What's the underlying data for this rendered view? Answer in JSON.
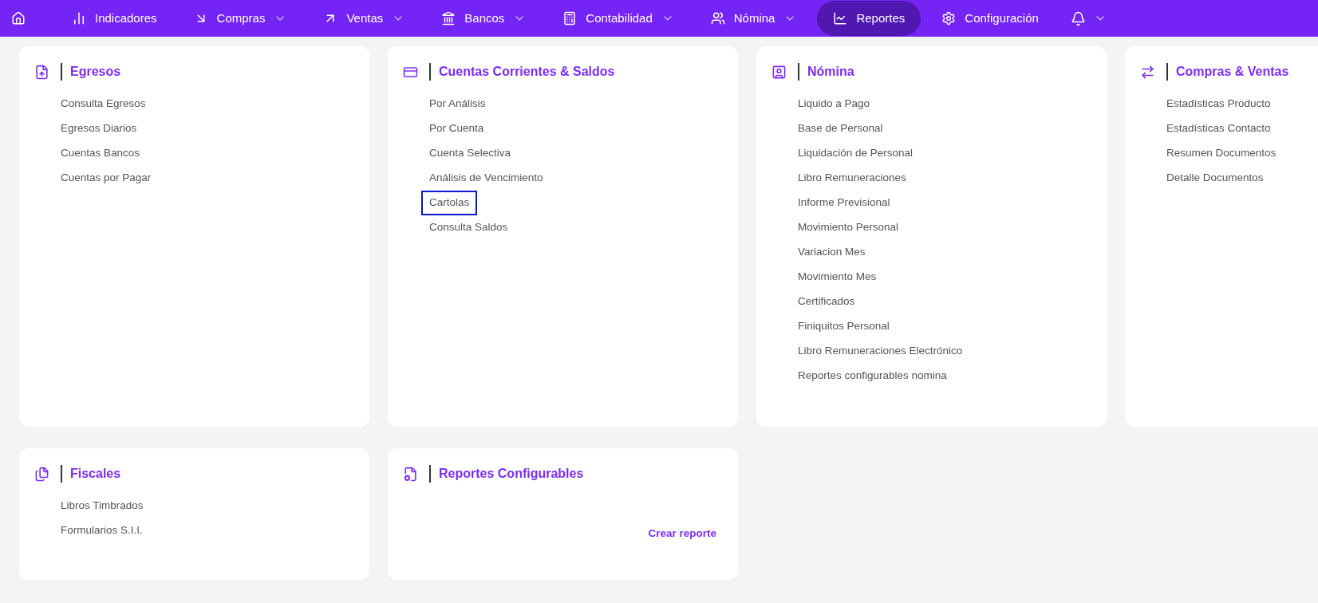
{
  "nav": {
    "items": [
      {
        "label": "Indicadores",
        "dropdown": false,
        "selected": false
      },
      {
        "label": "Compras",
        "dropdown": true,
        "selected": false
      },
      {
        "label": "Ventas",
        "dropdown": true,
        "selected": false
      },
      {
        "label": "Bancos",
        "dropdown": true,
        "selected": false
      },
      {
        "label": "Contabilidad",
        "dropdown": true,
        "selected": false
      },
      {
        "label": "Nómina",
        "dropdown": true,
        "selected": false
      },
      {
        "label": "Reportes",
        "dropdown": false,
        "selected": true
      },
      {
        "label": "Configuración",
        "dropdown": false,
        "selected": false
      }
    ],
    "notifications": {
      "dropdown": true
    }
  },
  "sections": [
    {
      "title": "Egresos",
      "items": [
        {
          "label": "Consulta Egresos",
          "focused": false
        },
        {
          "label": "Egresos Diarios",
          "focused": false
        },
        {
          "label": "Cuentas Bancos",
          "focused": false
        },
        {
          "label": "Cuentas por Pagar",
          "focused": false
        }
      ]
    },
    {
      "title": "Cuentas Corrientes & Saldos",
      "items": [
        {
          "label": "Por Análisis",
          "focused": false
        },
        {
          "label": "Por Cuenta",
          "focused": false
        },
        {
          "label": "Cuenta Selectiva",
          "focused": false
        },
        {
          "label": "Análisis de Vencimiento",
          "focused": false
        },
        {
          "label": "Cartolas",
          "focused": true
        },
        {
          "label": "Consulta Saldos",
          "focused": false
        }
      ]
    },
    {
      "title": "Nómina",
      "items": [
        {
          "label": "Liquido a Pago",
          "focused": false
        },
        {
          "label": "Base de Personal",
          "focused": false
        },
        {
          "label": "Liquidación de Personal",
          "focused": false
        },
        {
          "label": "Libro Remuneraciones",
          "focused": false
        },
        {
          "label": "Informe Previsional",
          "focused": false
        },
        {
          "label": "Movimiento Personal",
          "focused": false
        },
        {
          "label": "Variacion Mes",
          "focused": false
        },
        {
          "label": "Movimiento Mes",
          "focused": false
        },
        {
          "label": "Certificados",
          "focused": false
        },
        {
          "label": "Finiquitos Personal",
          "focused": false
        },
        {
          "label": "Libro Remuneraciones Electrónico",
          "focused": false
        },
        {
          "label": "Reportes configurables nomina",
          "focused": false
        }
      ]
    },
    {
      "title": "Compras & Ventas",
      "items": [
        {
          "label": "Estadísticas Producto",
          "focused": false
        },
        {
          "label": "Estadísticas Contacto",
          "focused": false
        },
        {
          "label": "Resumen Documentos",
          "focused": false
        },
        {
          "label": "Detalle Documentos",
          "focused": false
        }
      ]
    },
    {
      "title": "Fiscales",
      "items": [
        {
          "label": "Libros Timbrados",
          "focused": false
        },
        {
          "label": "Formularios S.I.I.",
          "focused": false
        }
      ]
    },
    {
      "title": "Reportes Configurables",
      "link": "Crear reporte"
    }
  ]
}
